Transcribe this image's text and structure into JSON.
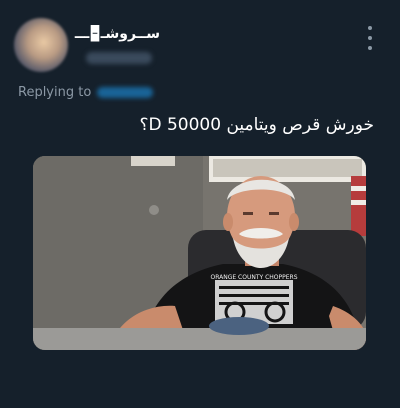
{
  "tweet": {
    "author": {
      "display_name": "ســروشـ🁢ـــ",
      "avatar_icon": "avatar-image"
    },
    "more_icon": "more-vertical-icon",
    "replying_to_label": "Replying to",
    "text": "خورش قرص ويتامين D 50000؟",
    "media": {
      "shirt_text": "ORANGE COUNTY CHOPPERS"
    }
  },
  "colors": {
    "background": "#15202b",
    "secondary_text": "#8b98a5",
    "accent": "#1d9bf0"
  }
}
